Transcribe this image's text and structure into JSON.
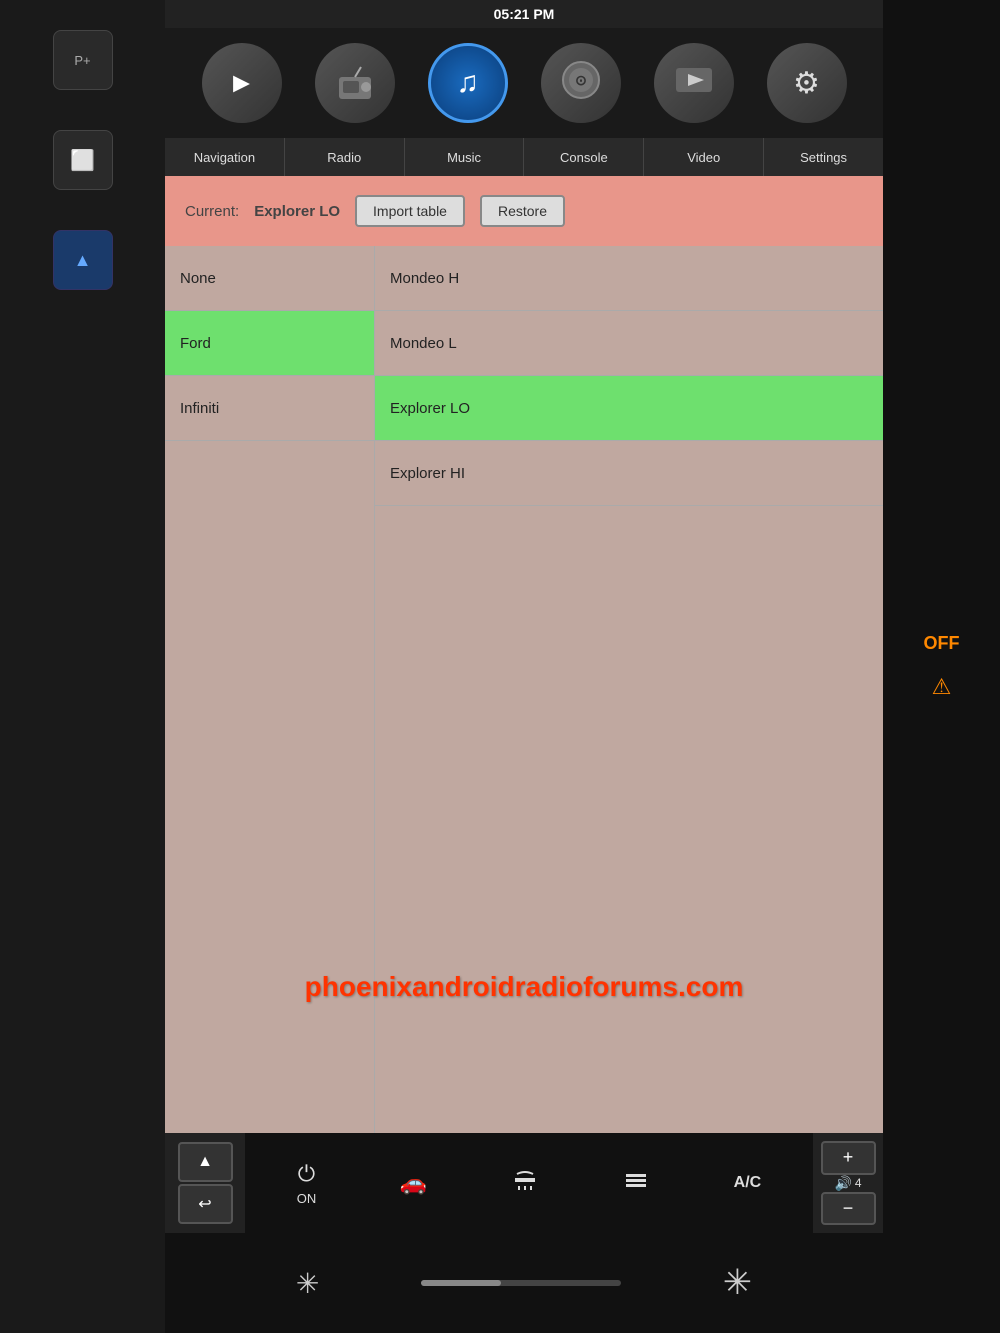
{
  "status_bar": {
    "time": "05:21 PM"
  },
  "nav_tabs": [
    {
      "id": "navigation",
      "label": "Navigation"
    },
    {
      "id": "radio",
      "label": "Radio"
    },
    {
      "id": "music",
      "label": "Music"
    },
    {
      "id": "console",
      "label": "Console"
    },
    {
      "id": "video",
      "label": "Video"
    },
    {
      "id": "settings",
      "label": "Settings"
    }
  ],
  "header": {
    "current_label": "Current:",
    "current_value": "Explorer LO",
    "import_btn": "Import table",
    "restore_btn": "Restore"
  },
  "left_column": [
    {
      "label": "None",
      "selected": false
    },
    {
      "label": "Ford",
      "selected": true
    },
    {
      "label": "Infiniti",
      "selected": false
    }
  ],
  "right_column": [
    {
      "label": "Mondeo H",
      "selected": false
    },
    {
      "label": "Mondeo L",
      "selected": false
    },
    {
      "label": "Explorer LO",
      "selected": true
    },
    {
      "label": "Explorer HI",
      "selected": false
    }
  ],
  "watermark": "phoenixandroidradioforums.com",
  "climate": {
    "on_label": "ON",
    "ac_label": "A/C"
  },
  "volume": {
    "level": "4",
    "plus": "+",
    "minus": "−"
  },
  "icons": {
    "nav": "▶",
    "radio": "📻",
    "music": "♫",
    "console": "🎮",
    "video": "▶",
    "settings": "⚙"
  }
}
